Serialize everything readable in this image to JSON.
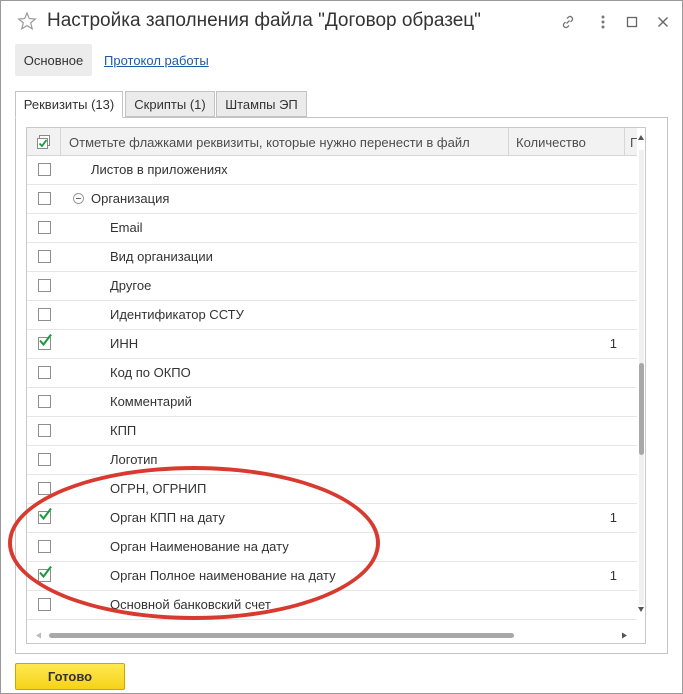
{
  "window": {
    "title": "Настройка заполнения файла \"Договор образец\""
  },
  "toolbar": {
    "main_button": "Основное",
    "log_link": "Протокол работы"
  },
  "tabs": [
    {
      "label": "Реквизиты (13)",
      "active": true
    },
    {
      "label": "Скрипты (1)",
      "active": false
    },
    {
      "label": "Штампы ЭП",
      "active": false
    }
  ],
  "table": {
    "columns": {
      "name": "Отметьте флажками реквизиты, которые нужно перенести в файл",
      "quantity": "Количество",
      "extra": "Г"
    },
    "rows": [
      {
        "label": "Листов в приложениях",
        "checked": false,
        "qty": "",
        "level": 0
      },
      {
        "label": "Организация",
        "checked": false,
        "qty": "",
        "level": 0,
        "group": true
      },
      {
        "label": "Email",
        "checked": false,
        "qty": "",
        "level": 1
      },
      {
        "label": "Вид организации",
        "checked": false,
        "qty": "",
        "level": 1
      },
      {
        "label": "Другое",
        "checked": false,
        "qty": "",
        "level": 1
      },
      {
        "label": "Идентификатор ССТУ",
        "checked": false,
        "qty": "",
        "level": 1
      },
      {
        "label": "ИНН",
        "checked": true,
        "qty": "1",
        "level": 1
      },
      {
        "label": "Код по ОКПО",
        "checked": false,
        "qty": "",
        "level": 1
      },
      {
        "label": "Комментарий",
        "checked": false,
        "qty": "",
        "level": 1
      },
      {
        "label": "КПП",
        "checked": false,
        "qty": "",
        "level": 1
      },
      {
        "label": "Логотип",
        "checked": false,
        "qty": "",
        "level": 1
      },
      {
        "label": "ОГРН, ОГРНИП",
        "checked": false,
        "qty": "",
        "level": 1
      },
      {
        "label": "Орган КПП на дату",
        "checked": true,
        "qty": "1",
        "level": 1
      },
      {
        "label": "Орган Наименование на дату",
        "checked": false,
        "qty": "",
        "level": 1
      },
      {
        "label": "Орган Полное наименование на дату",
        "checked": true,
        "qty": "1",
        "level": 1
      },
      {
        "label": "Основной банковский счет",
        "checked": false,
        "qty": "",
        "level": 1
      }
    ]
  },
  "footer": {
    "ok_button": "Готово"
  },
  "colors": {
    "accent_yellow": "#f5d21a",
    "link_blue": "#1e5aa8",
    "check_green": "#1a9a3c",
    "annotation_red": "#d83a30"
  }
}
